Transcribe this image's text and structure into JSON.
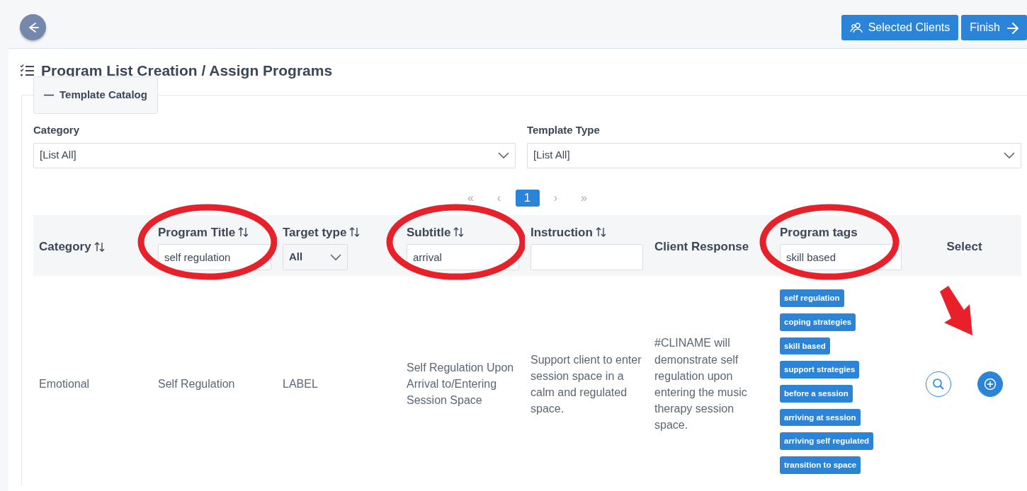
{
  "top_bar": {
    "back_button": true,
    "buttons": [
      {
        "label": "Selected Clients",
        "kind": "clients"
      },
      {
        "label": "Finish",
        "kind": "finish"
      }
    ]
  },
  "title": "Program List Creation / Assign Programs",
  "catalog": {
    "label": "Template Catalog",
    "expanded": true,
    "filters": [
      {
        "label": "Category",
        "value": "[List All]"
      },
      {
        "label": "Template Type",
        "value": "[List All]"
      }
    ]
  },
  "pagination": [
    {
      "label": "«",
      "selected": false
    },
    {
      "label": "‹",
      "selected": false
    },
    {
      "label": "1",
      "selected": true
    },
    {
      "label": "›",
      "selected": false
    },
    {
      "label": "»",
      "selected": false
    }
  ],
  "table": {
    "columns": [
      {
        "label": "Category",
        "sortable": true,
        "circled": false
      },
      {
        "label": "Program Title",
        "sortable": true,
        "filter": {
          "kind": "text",
          "value": "self regulation"
        },
        "circled": true
      },
      {
        "label": "Target type",
        "sortable": true,
        "filter": {
          "kind": "select",
          "value": "All"
        },
        "circled": false
      },
      {
        "label": "Subtitle",
        "sortable": true,
        "filter": {
          "kind": "text",
          "value": "arrival"
        },
        "circled": true
      },
      {
        "label": "Instruction",
        "sortable": true,
        "filter": {
          "kind": "text"
        },
        "circled": false
      },
      {
        "label": "Client Response",
        "sortable": false,
        "circled": false
      },
      {
        "label": "Program tags",
        "sortable": false,
        "filter": {
          "kind": "text",
          "value": "skill based"
        },
        "circled": true
      },
      {
        "label": "Select",
        "sortable": false,
        "circled": false
      }
    ],
    "rows": [
      {
        "cells": [
          "Emotional",
          "Self Regulation",
          "LABEL",
          "Self Regulation Upon Arrival to/Entering Session Space",
          "Support client to enter session space in a calm and regulated space.",
          "#CLINAME will demonstrate self regulation upon entering the music therapy session space."
        ],
        "tags": [
          "self regulation",
          "coping strategies",
          "skill based",
          "support strategies",
          "before a session",
          "arriving at session",
          "arriving self regulated",
          "transition to space"
        ],
        "actions": [
          {
            "kind": "view",
            "pointed_at": false
          },
          {
            "kind": "add",
            "pointed_at": true
          }
        ]
      }
    ]
  }
}
